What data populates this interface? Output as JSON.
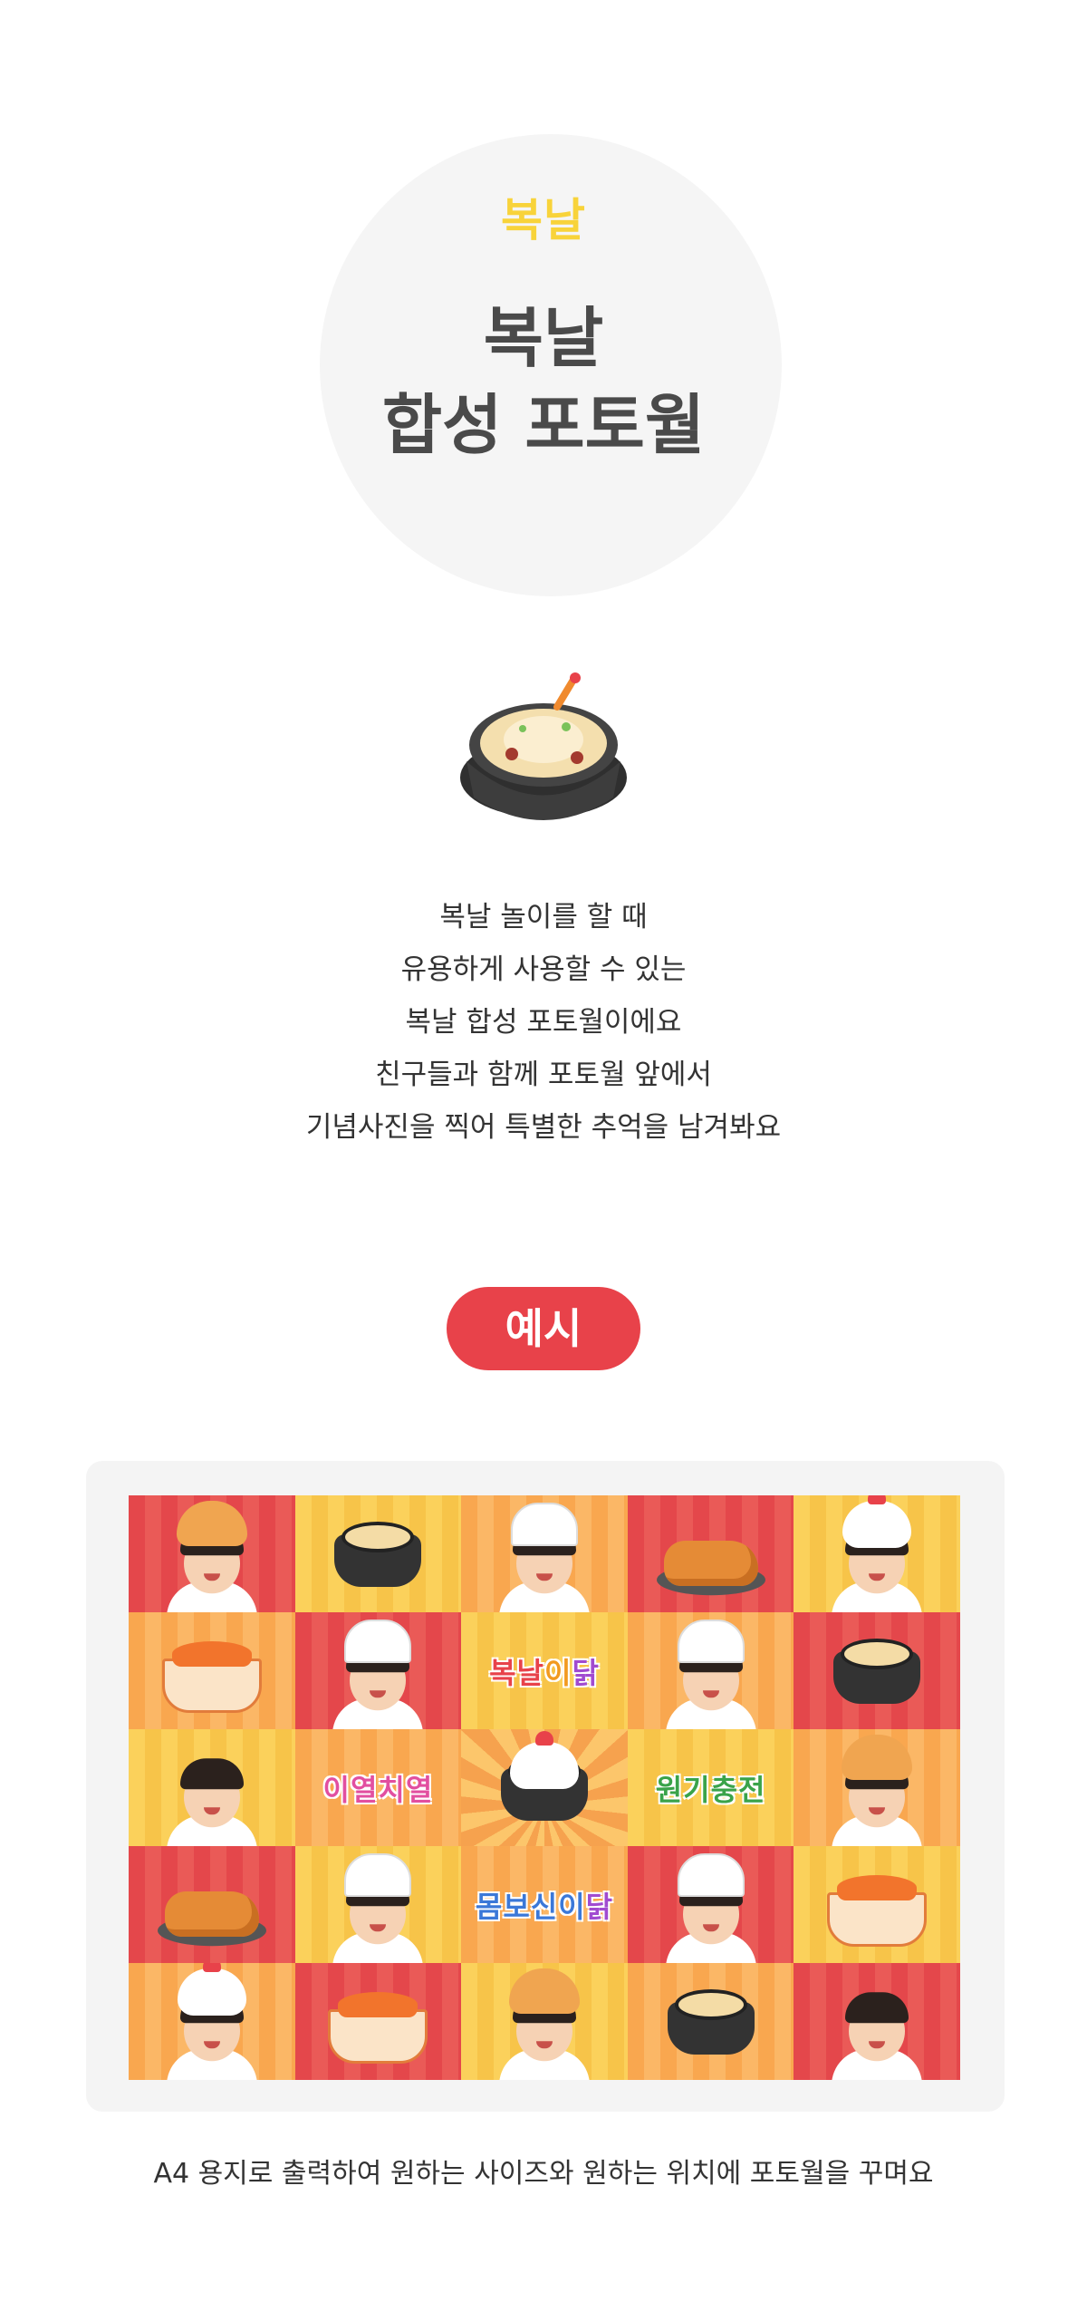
{
  "hero": {
    "tag": "복날",
    "title_line1": "복날",
    "title_line2": "합성 포토월"
  },
  "description": [
    "복날 놀이를 할 때",
    "유용하게 사용할 수 있는",
    "복날 합성 포토월이에요",
    "친구들과 함께 포토월 앞에서",
    "기념사진을 찍어 특별한 추억을 남겨봐요"
  ],
  "example_badge": "예시",
  "wall_words": {
    "w1": [
      "복날",
      "이",
      "닭"
    ],
    "w2": [
      "이열치열"
    ],
    "w3": [
      "원기충전"
    ],
    "w4": [
      "몸보신이",
      "닭"
    ]
  },
  "caption": "A4 용지로 출력하여 원하는 사이즈와 원하는 위치에 포토월을 꾸며요",
  "colors": {
    "accent_red": "#e8424a",
    "tag_yellow": "#f8d33a",
    "circle_gray": "#f5f5f5",
    "tile_red": "#e4474b",
    "tile_yellow": "#fbd15b",
    "tile_orange": "#f9a74f"
  }
}
